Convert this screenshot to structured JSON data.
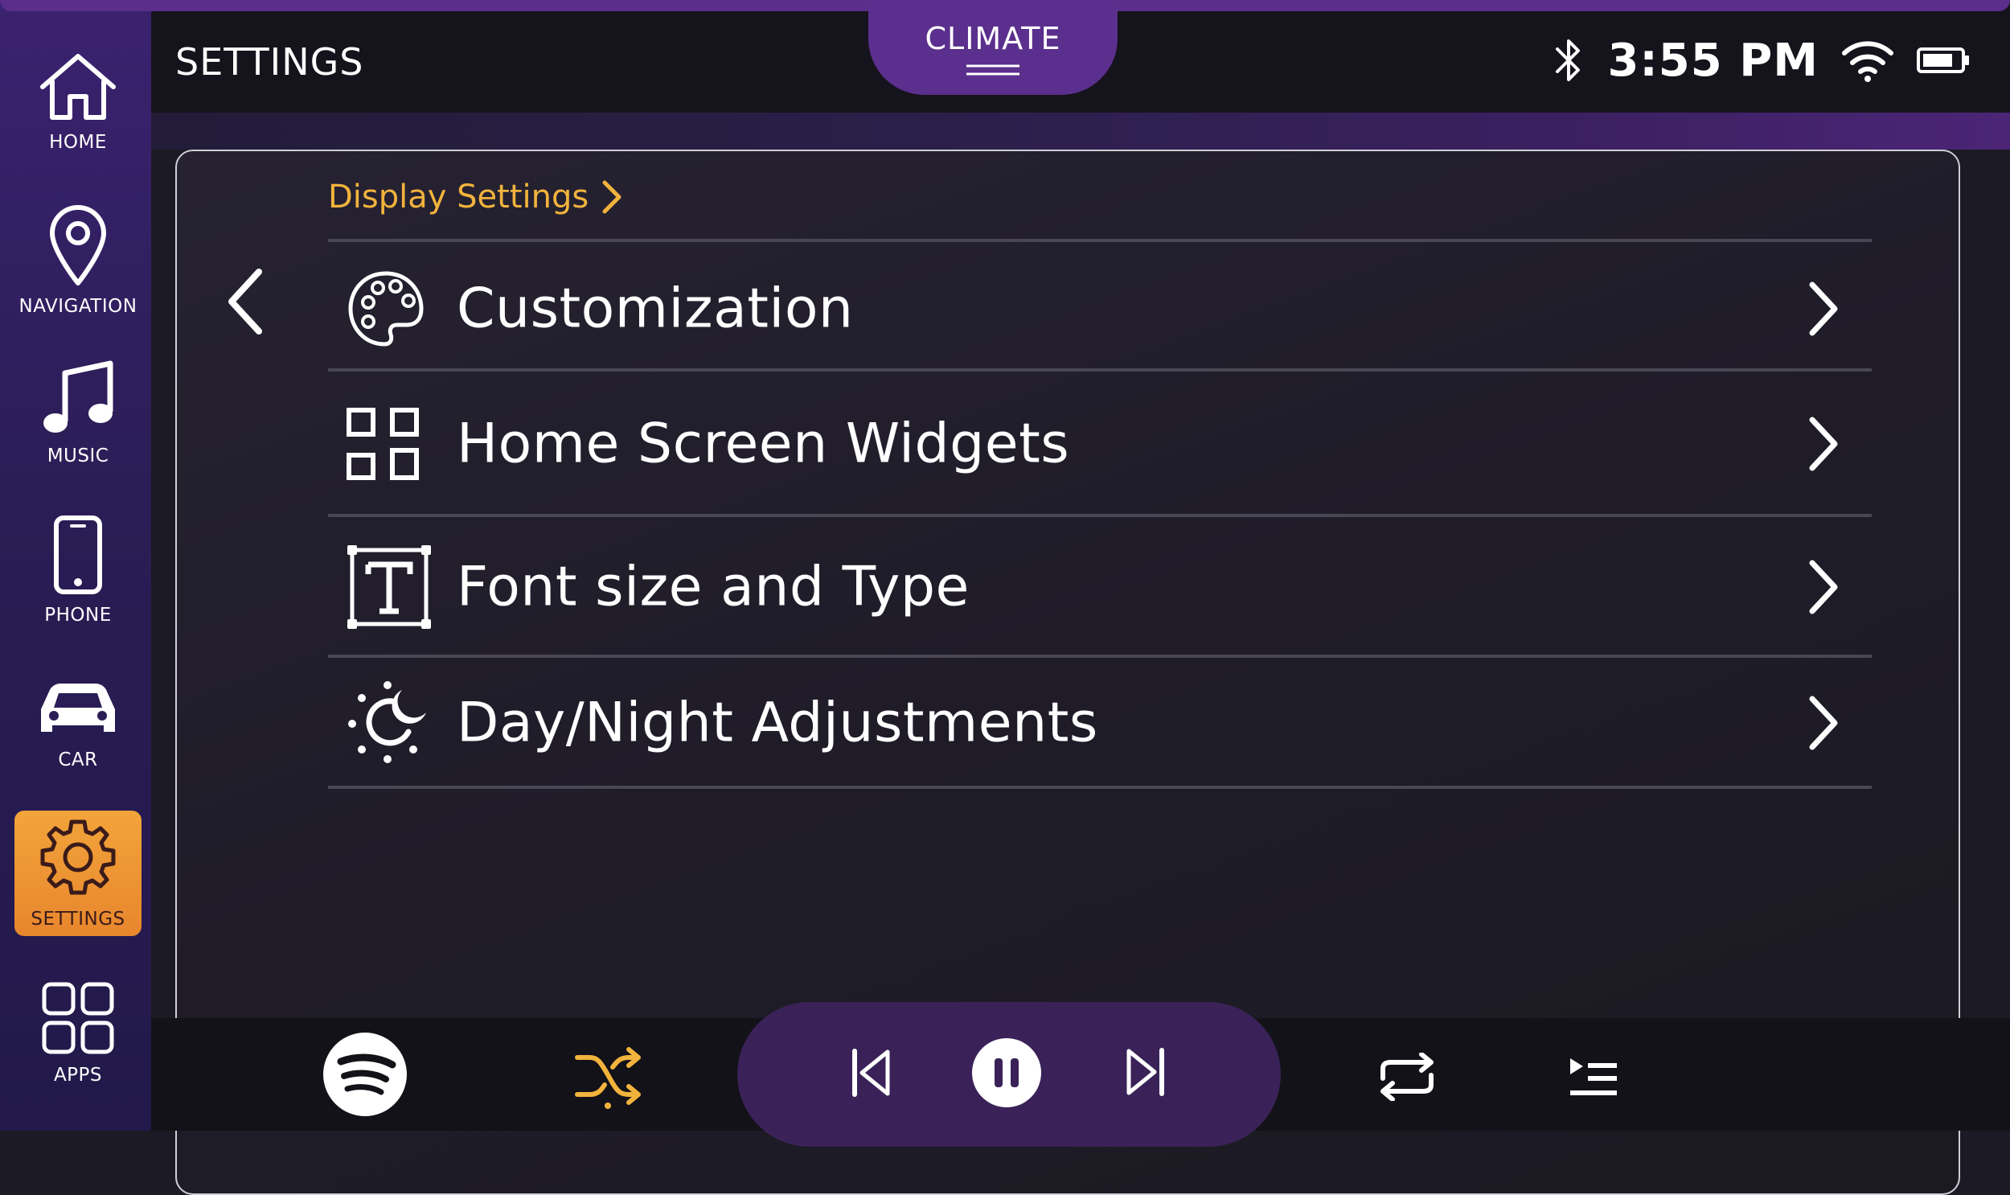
{
  "sidebar": {
    "items": [
      {
        "label": "HOME",
        "icon": "home-icon"
      },
      {
        "label": "NAVIGATION",
        "icon": "map-pin-icon"
      },
      {
        "label": "MUSIC",
        "icon": "music-note-icon"
      },
      {
        "label": "PHONE",
        "icon": "phone-icon"
      },
      {
        "label": "CAR",
        "icon": "car-icon"
      },
      {
        "label": "SETTINGS",
        "icon": "gear-icon",
        "active": true
      },
      {
        "label": "APPS",
        "icon": "apps-grid-icon"
      }
    ]
  },
  "header": {
    "title": "SETTINGS",
    "climate_label": "CLIMATE",
    "time": "3:55 PM",
    "status_icons": [
      "bluetooth-icon",
      "wifi-icon",
      "battery-icon"
    ]
  },
  "content": {
    "breadcrumb": "Display Settings",
    "menu": [
      {
        "label": "Customization",
        "icon": "palette-icon"
      },
      {
        "label": "Home Screen Widgets",
        "icon": "widgets-grid-icon"
      },
      {
        "label": "Font size and Type",
        "icon": "text-frame-icon"
      },
      {
        "label": "Day/Night Adjustments",
        "icon": "sun-moon-icon"
      }
    ]
  },
  "player": {
    "controls": [
      "spotify-icon",
      "shuffle-icon",
      "previous-icon",
      "pause-icon",
      "next-icon",
      "repeat-icon",
      "queue-icon"
    ]
  },
  "colors": {
    "accent": "#f2b33d",
    "active_nav": "#ee952f",
    "climate_tab": "#5b2f8d",
    "sidebar": "#2a1d55"
  }
}
